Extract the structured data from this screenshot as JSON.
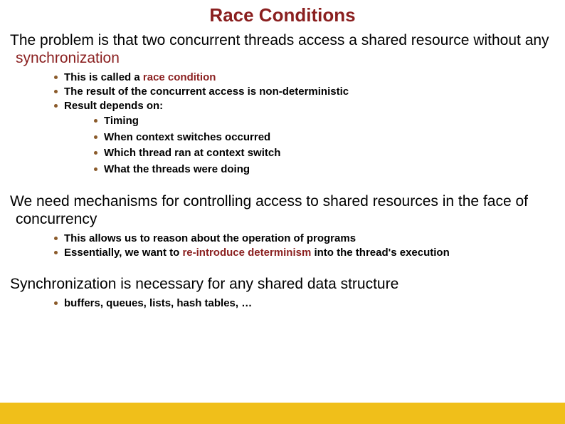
{
  "title": "Race Conditions",
  "b1": {
    "main_pre": "The problem is that two concurrent threads access a shared resource without any ",
    "main_accent": "synchronization",
    "i1_pre": "This is called a ",
    "i1_accent": "race condition",
    "i2": "The result of the concurrent access is non-deterministic",
    "i3": "Result depends on:",
    "s1": "Timing",
    "s2": "When context switches occurred",
    "s3": "Which thread ran at context switch",
    "s4": "What the threads were doing"
  },
  "b2": {
    "main": "We need mechanisms for controlling access to shared resources in the face of concurrency",
    "i1": "This allows us to reason about the operation of programs",
    "i2_pre": "Essentially, we want to ",
    "i2_accent": "re-introduce determinism",
    "i2_post": " into the thread's execution"
  },
  "b3": {
    "main": "Synchronization is necessary for any shared data structure",
    "i1": "buffers, queues, lists, hash tables, …"
  }
}
